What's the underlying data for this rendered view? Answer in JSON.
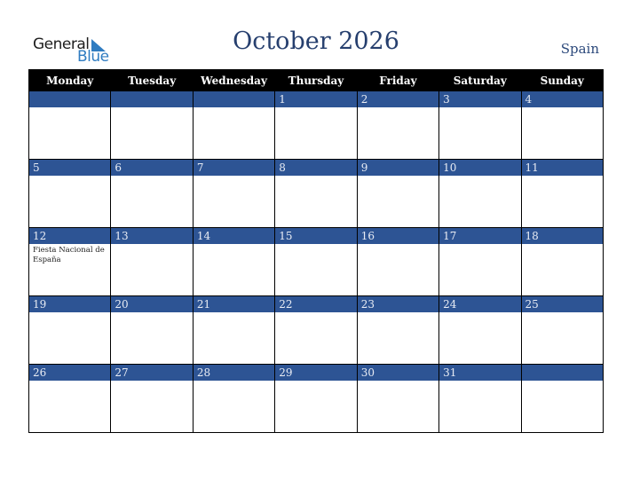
{
  "brand": {
    "line1": "General",
    "line2": "Blue",
    "icon": "triangle-icon",
    "accent": "#2f7cc1"
  },
  "title": "October 2026",
  "country": "Spain",
  "colors": {
    "header_bg": "#000000",
    "date_bar": "#2d5494",
    "title": "#263f6e"
  },
  "weekdays": [
    "Monday",
    "Tuesday",
    "Wednesday",
    "Thursday",
    "Friday",
    "Saturday",
    "Sunday"
  ],
  "weeks": [
    [
      {
        "day": ""
      },
      {
        "day": ""
      },
      {
        "day": ""
      },
      {
        "day": "1"
      },
      {
        "day": "2"
      },
      {
        "day": "3"
      },
      {
        "day": "4"
      }
    ],
    [
      {
        "day": "5"
      },
      {
        "day": "6"
      },
      {
        "day": "7"
      },
      {
        "day": "8"
      },
      {
        "day": "9"
      },
      {
        "day": "10"
      },
      {
        "day": "11"
      }
    ],
    [
      {
        "day": "12",
        "event": "Fiesta Nacional de España"
      },
      {
        "day": "13"
      },
      {
        "day": "14"
      },
      {
        "day": "15"
      },
      {
        "day": "16"
      },
      {
        "day": "17"
      },
      {
        "day": "18"
      }
    ],
    [
      {
        "day": "19"
      },
      {
        "day": "20"
      },
      {
        "day": "21"
      },
      {
        "day": "22"
      },
      {
        "day": "23"
      },
      {
        "day": "24"
      },
      {
        "day": "25"
      }
    ],
    [
      {
        "day": "26"
      },
      {
        "day": "27"
      },
      {
        "day": "28"
      },
      {
        "day": "29"
      },
      {
        "day": "30"
      },
      {
        "day": "31"
      },
      {
        "day": ""
      }
    ]
  ]
}
